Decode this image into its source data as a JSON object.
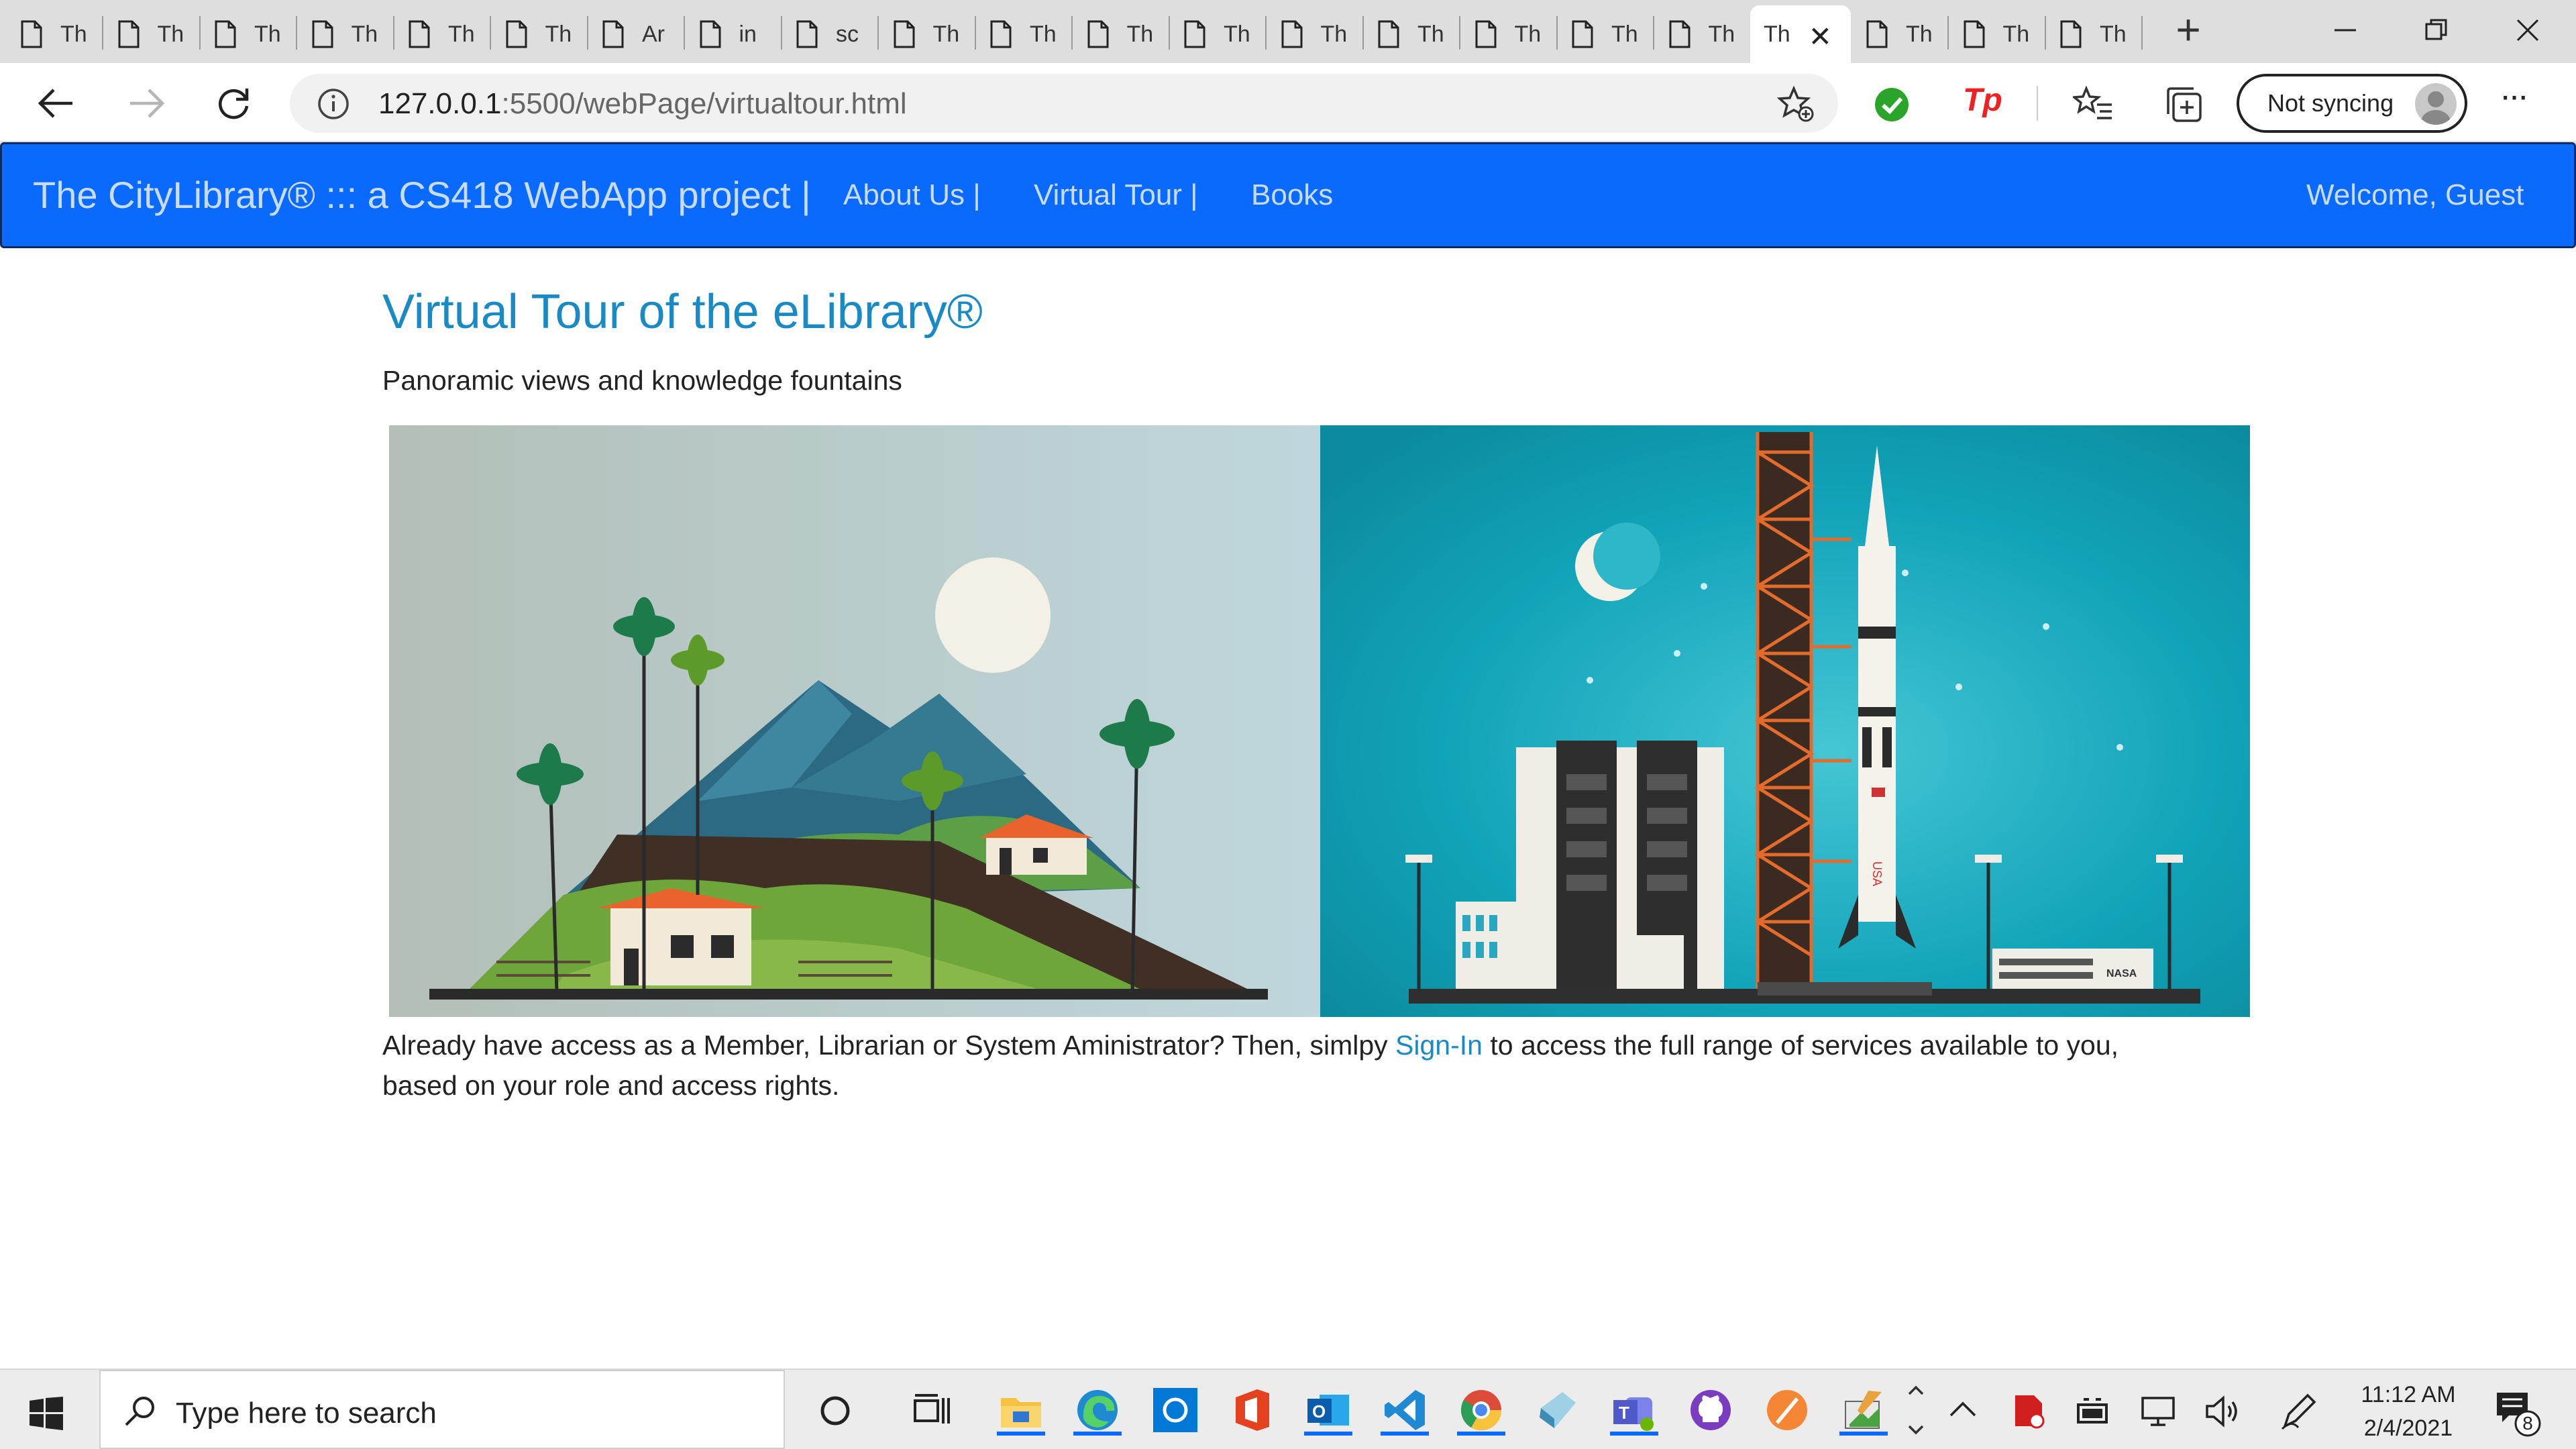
{
  "browser": {
    "tabs": [
      {
        "label": "Th"
      },
      {
        "label": "Th"
      },
      {
        "label": "Th"
      },
      {
        "label": "Th"
      },
      {
        "label": "Th"
      },
      {
        "label": "Th"
      },
      {
        "label": "Ar"
      },
      {
        "label": "in"
      },
      {
        "label": "sc"
      },
      {
        "label": "Th"
      },
      {
        "label": "Th"
      },
      {
        "label": "Th"
      },
      {
        "label": "Th"
      },
      {
        "label": "Th"
      },
      {
        "label": "Th"
      },
      {
        "label": "Th"
      },
      {
        "label": "Th"
      },
      {
        "label": "Th"
      },
      {
        "label": "Th",
        "active": true
      },
      {
        "label": "Th"
      },
      {
        "label": "Th"
      },
      {
        "label": "Th"
      }
    ],
    "new_tab": "+",
    "url_host": "127.0.0.1",
    "url_rest": ":5500/webPage/virtualtour.html",
    "sync_label": "Not syncing",
    "more": "···"
  },
  "navbar": {
    "brand": "The CityLibrary® ::: a CS418 WebApp project |",
    "links": [
      "About Us |",
      "Virtual Tour |",
      "Books"
    ],
    "welcome": "Welcome, Guest"
  },
  "page": {
    "title": "Virtual Tour of the eLibrary®",
    "subtitle": "Panoramic views and knowledge fountains",
    "para_before": "Already have access as a Member, Librarian or System Aministrator? Then, simlpy ",
    "signin": "Sign-In",
    "para_after": " to access the full range of services available to you, based on your role and access rights.",
    "image_labels": {
      "flag": "USA",
      "building": "NASA"
    }
  },
  "taskbar": {
    "search_placeholder": "Type here to search",
    "time": "11:12 AM",
    "date": "2/4/2021",
    "notifications": "8"
  },
  "colors": {
    "navbar": "#0a6afd",
    "link": "#1a8ac4",
    "taskbar_accent": "#0a6afd"
  }
}
